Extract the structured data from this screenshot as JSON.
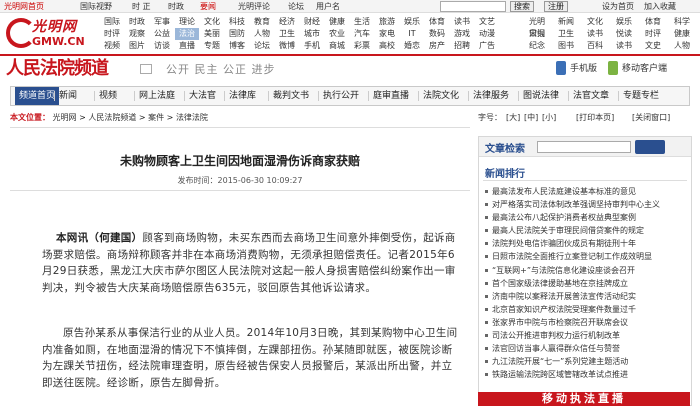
{
  "topbar": {
    "links": [
      "光明网首页",
      "国际视野",
      "时 正",
      "时政",
      "要闻",
      "光明评论",
      "论坛",
      "用户名"
    ],
    "search_btn": "搜索",
    "register": "注册",
    "right_links": [
      "设为首页",
      "加入收藏"
    ]
  },
  "logo": {
    "text1": "光明网",
    "text2": "GMW.CN"
  },
  "channels_row1": [
    "国际",
    "时政",
    "军事",
    "理论",
    "文化",
    "科技",
    "教育",
    "经济",
    "财经",
    "健康",
    "生活",
    "旅游",
    "娱乐",
    "体育",
    "读书",
    "文艺",
    "书画",
    "收藏"
  ],
  "channels_row2": [
    "时评",
    "观察",
    "公益",
    "法治",
    "美丽",
    "国防",
    "人物",
    "卫生",
    "城市",
    "农业",
    "汽车",
    "家电",
    "IT",
    "数码",
    "游戏",
    "动漫",
    "美食",
    "社区"
  ],
  "channels_row3": [
    "视频",
    "图片",
    "访谈",
    "直播",
    "专题",
    "博客",
    "论坛",
    "微博",
    "手机",
    "商城",
    "彩票",
    "高校",
    "婚恋",
    "房产",
    "招聘",
    "广告",
    "服务",
    "关于"
  ],
  "channels_right": [
    "光明日报",
    "新闻",
    "文化",
    "娱乐",
    "体育",
    "科学",
    "宋词",
    "卫生",
    "读书",
    "悦读",
    "时评",
    "健康",
    "纪念",
    "图书",
    "百科",
    "读书",
    "文史",
    "人物"
  ],
  "channel_selected": "法治",
  "banner": {
    "title": "人民法院频道",
    "slogan": "公开 民主 公正 进步",
    "mobile1": "手机版",
    "mobile2": "移动客户端"
  },
  "nav": {
    "items": [
      "频道首页",
      "新闻",
      "视频",
      "网上法庭",
      "大法官",
      "法律库",
      "裁判文书",
      "执行公开",
      "庭审直播",
      "法院文化",
      "法律服务",
      "图说法律",
      "法官文章",
      "专题专栏"
    ],
    "active": 0
  },
  "breadcrumb": {
    "label": "本文位置：",
    "path": [
      "光明网",
      "人民法院频道",
      "案件",
      "法律法院"
    ]
  },
  "tools": [
    "字号：",
    "[大]",
    "[中]",
    "[小]",
    "[打印本页]",
    "[关闭窗口]"
  ],
  "article": {
    "title": "未购物顾客上卫生间因地面湿滑伤诉商家获赔",
    "time": "发布时间：2015-06-30 10:09:27",
    "p1_lead": "本网讯（何建国）",
    "p1": "顾客到商场购物，未买东西而去商场卫生间意外摔倒受伤，起诉商场要求赔偿。商场辩称顾客并非在本商场消费购物，无须承担赔偿责任。记者2015年6月29日获悉，黑龙江大庆市萨尔图区人民法院对这起一般人身损害赔偿纠纷案作出一审判决，判令被告大庆某商场赔偿原告635元，驳回原告其他诉讼请求。",
    "p2": "原告孙某系从事保洁行业的从业人员。2014年10月3日晚，其到某购物中心卫生间内准备如厕，在地面湿滑的情况下不慎摔倒，左踝部扭伤。孙某随即就医，被医院诊断为左踝关节扭伤，经法院审理查明，原告经被告保安人员报警后，某派出所出警，并立即送往医院。经诊断，原告左脚骨折。"
  },
  "sidebar": {
    "search_title": "文章检索",
    "hot_title": "新闻排行",
    "hot_items": [
      "最高法发布人民法庭建设基本标准的意见",
      "对严格落实司法体制改革强调坚持审判中心主义",
      "最高法公布八起保护消费者权益典型案例",
      "最高人民法院关于审理民间借贷案件的规定",
      "法院判处电信诈骗团伙成员有期徒刑十年",
      "日照市法院全面推行立案登记制工作成效明显",
      "“互联网+”与法院信息化建设座谈会召开",
      "首个国家级法律援助基地在京挂牌成立",
      "济南中院以案释法开展普法宣传活动纪实",
      "北京首家知识产权法院受理案件数量过千",
      "张家界市中院与市检察院召开联席会议",
      "司法公开推进审判权力运行机制改革",
      "法官回访当事人赢得群众信任与赞誉",
      "九江法院开展“七一”系列党建主题活动",
      "铁路运输法院跨区域管辖改革试点推进"
    ],
    "ad_text": "移动执法直播"
  }
}
